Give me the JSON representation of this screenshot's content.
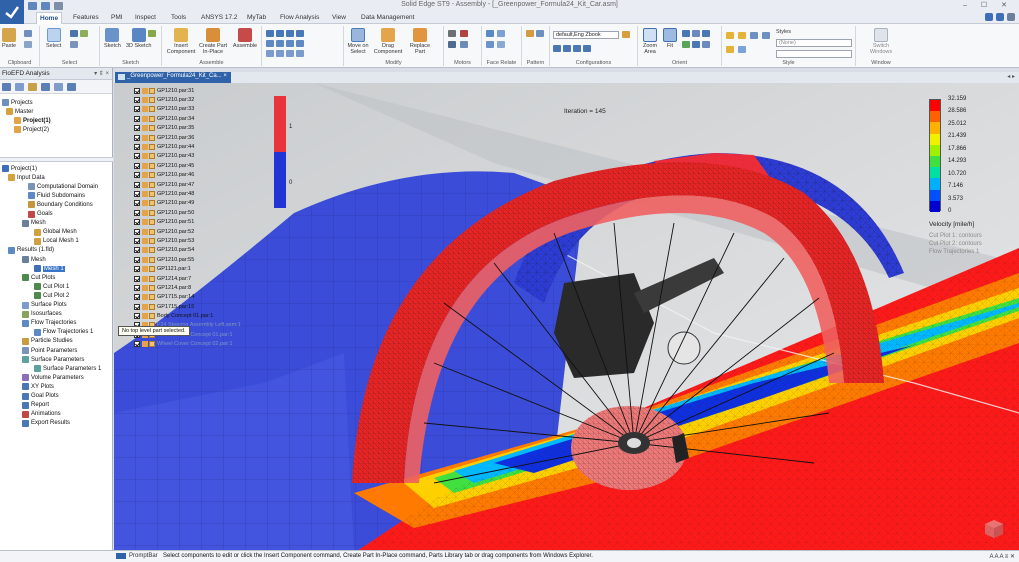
{
  "window": {
    "title": "Solid Edge ST9 - Assembly - [_Greenpower_Formula24_Kit_Car.asm]",
    "controls": "– ☐ ✕"
  },
  "tabs": [
    "Home",
    "Features",
    "PMI",
    "Inspect",
    "Tools",
    "ANSYS 17.2",
    "MyTab",
    "Flow Analysis",
    "View",
    "Data Management"
  ],
  "ribbon": {
    "groups": {
      "clipboard": "Clipboard",
      "select": "Select",
      "sketch": "Sketch",
      "assemble": "Assemble",
      "modify": "Modify",
      "motors": "Motors",
      "face_relate": "Face Relate",
      "pattern": "Pattern",
      "configurations": "Configurations",
      "orient": "Orient",
      "style": "Style",
      "window": "Window"
    },
    "buttons": {
      "paste": "Paste",
      "select": "Select",
      "sketch": "Sketch",
      "sketch3d": "3D Sketch",
      "insert_component": "Insert Component",
      "create_part": "Create Part In-Place",
      "assemble": "Assemble",
      "move_on_select": "Move on Select",
      "drag_component": "Drag Component",
      "replace_part": "Replace Part",
      "zoom_area": "Zoom Area",
      "fit": "Fit",
      "styles": "Styles",
      "switch_windows": "Switch Windows"
    },
    "config_value": "default,Eng Zbook",
    "style_value": "(None)"
  },
  "left_panel": {
    "title": "FloEFD Analysis",
    "pin": "▾ ⇕ ×",
    "top_tree": [
      {
        "label": "Projects"
      },
      {
        "label": "Master"
      },
      {
        "label": "Project(1)",
        "bold": true
      },
      {
        "label": "Project(2)"
      }
    ],
    "tree": [
      {
        "label": "Project(1)"
      },
      {
        "label": "Input Data"
      },
      {
        "label": "Computational Domain"
      },
      {
        "label": "Fluid Subdomains"
      },
      {
        "label": "Boundary Conditions"
      },
      {
        "label": "Goals"
      },
      {
        "label": "Mesh"
      },
      {
        "label": "Global Mesh"
      },
      {
        "label": "Local Mesh 1"
      },
      {
        "label": "Results (1.fld)"
      },
      {
        "label": "Mesh"
      },
      {
        "label": "Mesh 1",
        "selected": true
      },
      {
        "label": "Cut Plots"
      },
      {
        "label": "Cut Plot 1"
      },
      {
        "label": "Cut Plot 2"
      },
      {
        "label": "Surface Plots"
      },
      {
        "label": "Isosurfaces"
      },
      {
        "label": "Flow Trajectories"
      },
      {
        "label": "Flow Trajectories 1"
      },
      {
        "label": "Particle Studies"
      },
      {
        "label": "Point Parameters"
      },
      {
        "label": "Surface Parameters"
      },
      {
        "label": "Surface Parameters 1"
      },
      {
        "label": "Volume Parameters"
      },
      {
        "label": "XY Plots"
      },
      {
        "label": "Goal Plots"
      },
      {
        "label": "Report"
      },
      {
        "label": "Animations"
      },
      {
        "label": "Export Results"
      }
    ]
  },
  "doc_tab": {
    "label": "_Greenpower_Formula24_Kit_Ca... ×",
    "right": "◂ ▸"
  },
  "assembly_list": [
    "GP1210.par:31",
    "GP1210.par:32",
    "GP1210.par:33",
    "GP1210.par:34",
    "GP1210.par:35",
    "GP1210.par:36",
    "GP1210.par:44",
    "GP1210.par:43",
    "GP1210.par:45",
    "GP1210.par:46",
    "GP1210.par:47",
    "GP1210.par:48",
    "GP1210.par:49",
    "GP1210.par:50",
    "GP1210.par:51",
    "GP1210.par:52",
    "GP1210.par:53",
    "GP1210.par:54",
    "GP1210.par:55",
    "GP1121.par:1",
    "GP1214.par:7",
    "GP1214.par:8",
    "GP1715.par:14",
    "GP1715.par:15",
    "Body Concept 01.par:1",
    "F24 Steering Assembly Left.asm:1",
    "Wheel Cover Concept 01.par:1",
    "Wheel Cover Concept 02.par:1"
  ],
  "tooltip": "No top level part selected.",
  "iteration": "Iteration = 145",
  "small_scale": {
    "top": "1",
    "mid": "0"
  },
  "legend": {
    "values": [
      "32.159",
      "28.586",
      "25.012",
      "21.439",
      "17.866",
      "14.293",
      "10.720",
      "7.146",
      "3.573",
      "0"
    ],
    "units": "Velocity [mile/h]",
    "notes": [
      "Cut Plot 1: contours",
      "Cut Plot 2: contours",
      "Flow Trajectories 1"
    ],
    "colors": [
      "#ff0000",
      "#ff6000",
      "#ffb000",
      "#f0f000",
      "#a0f000",
      "#40e040",
      "#00e0a0",
      "#00b0ff",
      "#0050ff",
      "#0000d0"
    ]
  },
  "prompt": {
    "label": "PromptBar",
    "text": "Select components to edit or click the Insert Component command, Create Part In-Place command, Parts Library tab or drag components from Windows Explorer.",
    "right": "A A A ≡ ✕"
  }
}
